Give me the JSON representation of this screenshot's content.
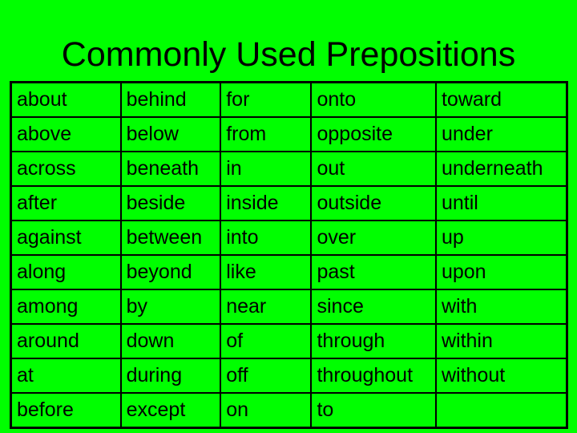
{
  "title": "Commonly Used Prepositions",
  "table": {
    "rows": [
      [
        "about",
        "behind",
        "for",
        "onto",
        "toward"
      ],
      [
        "above",
        "below",
        "from",
        "opposite",
        "under"
      ],
      [
        "across",
        "beneath",
        "in",
        "out",
        "underneath"
      ],
      [
        "after",
        "beside",
        "inside",
        "outside",
        "until"
      ],
      [
        "against",
        "between",
        "into",
        "over",
        "up"
      ],
      [
        "along",
        "beyond",
        "like",
        "past",
        "upon"
      ],
      [
        "among",
        "by",
        "near",
        "since",
        "with"
      ],
      [
        "around",
        "down",
        "of",
        "through",
        "within"
      ],
      [
        "at",
        "during",
        "off",
        "throughout",
        "without"
      ],
      [
        "before",
        "except",
        "on",
        "to",
        ""
      ]
    ]
  },
  "colors": {
    "background": "#00ff00",
    "text": "#000000"
  }
}
